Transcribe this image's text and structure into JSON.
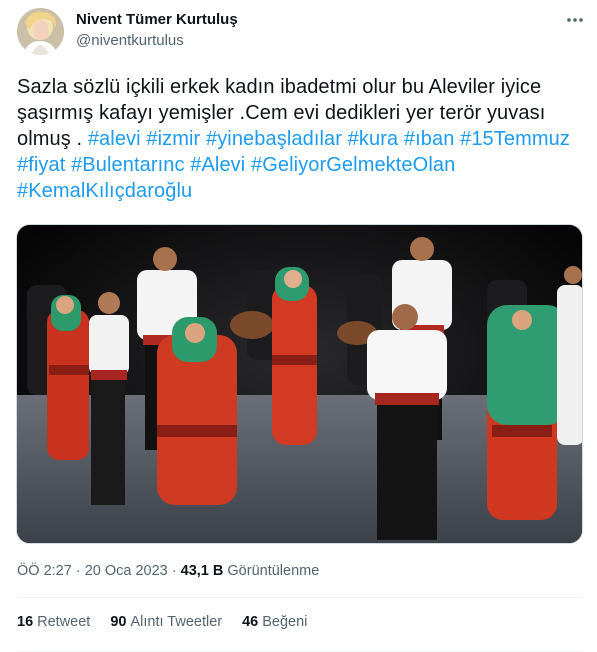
{
  "author": {
    "display_name": "Nivent Tümer Kurtuluş",
    "handle": "@niventkurtulus"
  },
  "tweet": {
    "text_plain": "Sazla sözlü içkili erkek kadın ibadetmi olur bu Aleviler iyice şaşırmış kafayı yemişler .Cem evi dedikleri yer terör yuvası olmuş . ",
    "hashtags": [
      "#alevi",
      "#izmir",
      "#yinebaşladılar",
      "#kura",
      "#ıban",
      "#15Temmuz",
      "#fiyat",
      "#Bulentarınc",
      "#Alevi",
      "#GeliyorGelmekteOlan",
      "#KemalKılıçdaroğlu"
    ]
  },
  "meta": {
    "time": "ÖÖ 2:27",
    "separator": " · ",
    "date": "20 Oca 2023",
    "views_count": "43,1 B",
    "views_label": "Görüntülenme"
  },
  "stats": {
    "retweets": {
      "count": "16",
      "label": "Retweet"
    },
    "quotes": {
      "count": "90",
      "label": "Alıntı Tweetler"
    },
    "likes": {
      "count": "46",
      "label": "Beğeni"
    }
  },
  "icons": {
    "more": "more-horizontal-icon"
  },
  "colors": {
    "hashtag": "#1d9bf0",
    "text": "#0f1419",
    "secondary": "#536471",
    "divider": "#eff3f4"
  }
}
